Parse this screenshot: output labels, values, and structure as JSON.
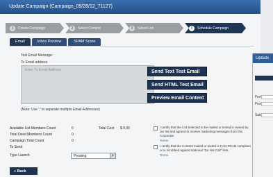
{
  "window": {
    "title": "Update Campaign (Campaign_09/28/12_71127)"
  },
  "wizard": {
    "steps": [
      {
        "num": "1",
        "label": "Create Campaign"
      },
      {
        "num": "2",
        "label": "Select Content"
      },
      {
        "num": "3",
        "label": "Select List"
      },
      {
        "num": "4",
        "label": "Schedule Campaign"
      }
    ]
  },
  "tabs": [
    "Email",
    "Inbox Preview",
    "SPAM Score"
  ],
  "email": {
    "test_label": "Test Email Message:",
    "to_label": "To Email address",
    "to_placeholder": "Enter To Email Address",
    "note": "(Note: Use ';' to separate multiple Email Addresses)"
  },
  "buttons": {
    "send_text": "Send Text Test Email",
    "send_html": "Send HTML Test Email",
    "preview": "Preview Email Content",
    "back": "« Back"
  },
  "summary": {
    "available_label": "Available List Members Count",
    "available_value": "0",
    "deed_label": "Total Deed Members Count",
    "deed_value": "0",
    "campaign_label": "Campaign Total Count",
    "campaign_value": "0",
    "to_send_label": "To Send",
    "type_launch_label": "Type Launch",
    "type_launch_value": "Pending",
    "total_cost_label": "Total Cost",
    "total_cost_value": "$ 0.00"
  },
  "certify": {
    "c1": "I certify that the List Selected to be mailed or texted is owned by our list and agreed to receive marketing messages from this Corporate.",
    "c2": "I certify that the Content mailed or texted is CAN-SPAM compliant or is scrubbed against National \"Do Not Call\" lists.",
    "terms": "Terms"
  },
  "overlay": {
    "title": "Update",
    "labels": [
      "From",
      "From",
      "Subje"
    ]
  }
}
